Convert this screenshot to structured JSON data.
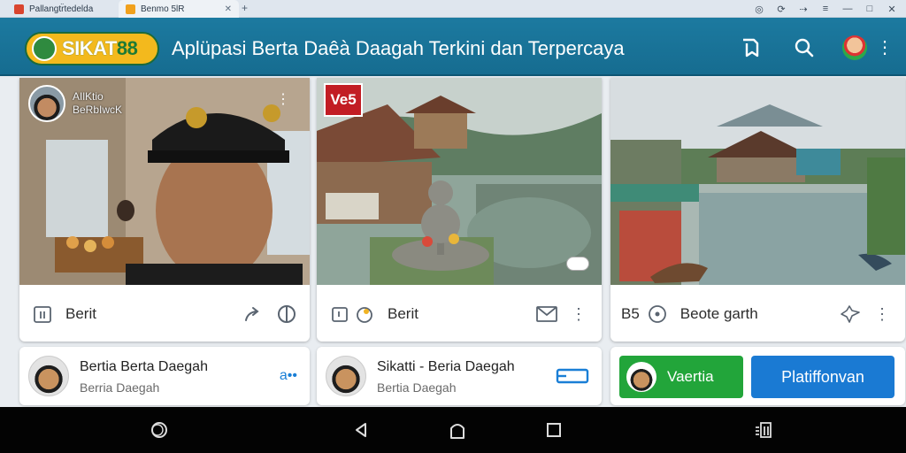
{
  "browser": {
    "tabs": [
      {
        "label": "Pallangtr̈tedelda",
        "favicon_color": "#d9452e"
      },
      {
        "label": "Benmo 5lR",
        "favicon_color": "#f1a11d"
      }
    ],
    "new_tab_symbol": "+"
  },
  "header": {
    "logo": {
      "text_main": "SIKAT",
      "text_num": "88"
    },
    "title": "Aplüpasi Berta Daêà Daagah Terkini dan Terpercaya",
    "icons": [
      "bookmark-icon",
      "search-icon",
      "avatar",
      "more-icon"
    ],
    "accent": "#1c7aa0"
  },
  "cards": [
    {
      "author_name": "AIlKtio",
      "author_sub": "BeRbIwcK",
      "action_label": "Berit",
      "icons": [
        "bookmark-frame-icon",
        "share-icon",
        "reaction-icon"
      ]
    },
    {
      "badge": "Ve5",
      "action_label": "Berit",
      "icons": [
        "save-icon",
        "timer-icon",
        "message-icon",
        "more-icon"
      ]
    },
    {
      "action_label": "Beote garth",
      "prefix": "B5",
      "icons": [
        "timer-icon",
        "share-icon",
        "more-icon"
      ]
    }
  ],
  "lower": [
    {
      "title": "Bertia Berta Daegah",
      "subtitle": "Berria Daegah",
      "action": "a••"
    },
    {
      "title": "Sikatti - Beria Daegah",
      "subtitle": "Bertia Daegah",
      "action": "window-icon"
    },
    {
      "green_label": "Vaertia",
      "blue_label": "Platiffonvan"
    }
  ],
  "navbar": {
    "icons": [
      "circle-icon",
      "back-icon",
      "home-icon",
      "recents-icon",
      "apps-icon"
    ]
  }
}
